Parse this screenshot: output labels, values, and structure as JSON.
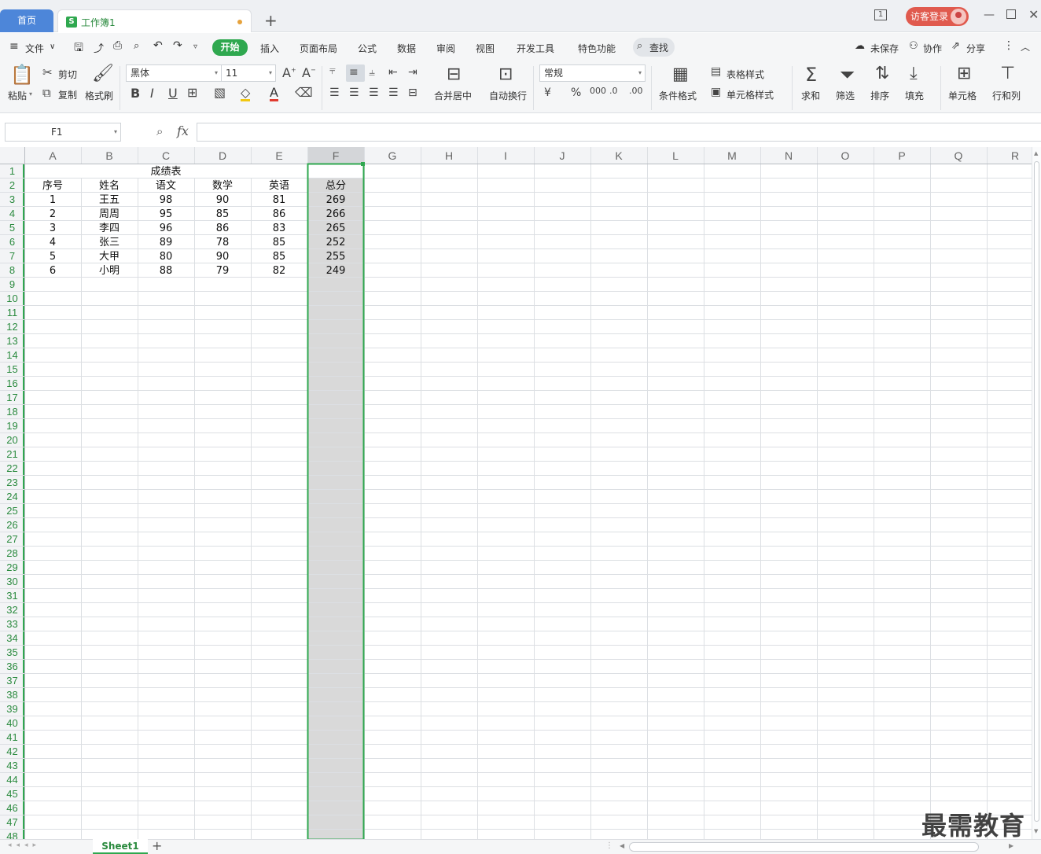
{
  "titlebar": {
    "home_tab": "首页",
    "book_tab": "工作簿1",
    "book_icon": "S",
    "login": "访客登录"
  },
  "menubar": {
    "file": "文件",
    "tabs": [
      "开始",
      "插入",
      "页面布局",
      "公式",
      "数据",
      "审阅",
      "视图",
      "开发工具",
      "特色功能"
    ],
    "search": "查找",
    "unsaved": "未保存",
    "collab": "协作",
    "share": "分享"
  },
  "ribbon": {
    "paste": "粘贴",
    "cut": "剪切",
    "copy": "复制",
    "format_painter": "格式刷",
    "font_name": "黑体",
    "font_size": "11",
    "merge_center": "合并居中",
    "wrap_text": "自动换行",
    "number_format": "常规",
    "conditional_format": "条件格式",
    "table_style": "表格样式",
    "cell_style": "单元格样式",
    "sum": "求和",
    "filter": "筛选",
    "sort": "排序",
    "fill": "填充",
    "cell": "单元格",
    "row_col": "行和列"
  },
  "formula_bar": {
    "name_box": "F1",
    "fx": "fx",
    "value": ""
  },
  "sheet": {
    "columns": [
      "A",
      "B",
      "C",
      "D",
      "E",
      "F",
      "G",
      "H",
      "I",
      "J",
      "K",
      "L",
      "M",
      "N",
      "O",
      "P",
      "Q",
      "R"
    ],
    "row_count": 48,
    "selected_column": "F",
    "title": "成绩表",
    "headers": [
      "序号",
      "姓名",
      "语文",
      "数学",
      "英语",
      "总分"
    ],
    "rows": [
      [
        "1",
        "王五",
        "98",
        "90",
        "81",
        "269"
      ],
      [
        "2",
        "周周",
        "95",
        "85",
        "86",
        "266"
      ],
      [
        "3",
        "李四",
        "96",
        "86",
        "83",
        "265"
      ],
      [
        "4",
        "张三",
        "89",
        "78",
        "85",
        "252"
      ],
      [
        "5",
        "大甲",
        "80",
        "90",
        "85",
        "255"
      ],
      [
        "6",
        "小明",
        "88",
        "79",
        "82",
        "249"
      ]
    ]
  },
  "sheetbar": {
    "sheet_name": "Sheet1"
  },
  "watermark": "最需教育",
  "colors": {
    "accent_green": "#2fa84f",
    "home_tab_blue": "#4d86d9",
    "login_red": "#e05a4e",
    "selection_gray": "#d9d9d9"
  }
}
